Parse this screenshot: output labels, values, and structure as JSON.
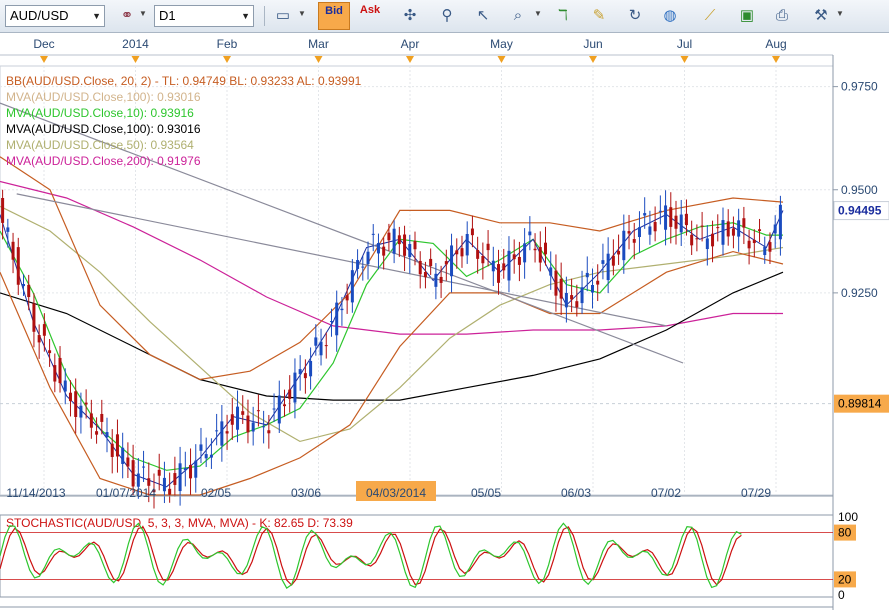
{
  "toolbar": {
    "symbol": "AUD/USD",
    "timeframe": "D1",
    "bid_label": "Bid",
    "ask_label": "Ask",
    "icons": [
      "link-icon",
      "line-chart-icon",
      "crosshair-icon",
      "zoom-icon",
      "cursor-icon",
      "zoom-in-icon",
      "zoom-out-icon",
      "indicator-icon",
      "drawing-icon",
      "refresh-icon",
      "globe-icon",
      "ruler-icon",
      "image-icon",
      "print-icon",
      "tools-icon"
    ]
  },
  "chart_data": {
    "type": "candlestick",
    "top_axis_labels": [
      "Dec",
      "2014",
      "Feb",
      "Mar",
      "Apr",
      "May",
      "Jun",
      "Jul",
      "Aug"
    ],
    "bottom_axis_labels": [
      "11/14/2013",
      "01/07/2014",
      "02/05",
      "03/06",
      "04/03/2014",
      "05/05",
      "06/03",
      "07/02",
      "07/29"
    ],
    "highlighted_date": "04/03/2014",
    "ylim": [
      0.876,
      0.98
    ],
    "yticks": [
      "0.9750",
      "0.9500",
      "0.9250"
    ],
    "current_price": "0.94495",
    "marked_level": "0.89814",
    "indicator_labels": [
      {
        "text": "BB(AUD/USD.Close, 20, 2) -  TL: 0.94749  BL: 0.93233  AL: 0.93991",
        "color": "#c65d22"
      },
      {
        "text": "MVA(AUD/USD.Close,100): 0.93016",
        "color": "#d2b48c"
      },
      {
        "text": "MVA(AUD/USD.Close,10): 0.93916",
        "color": "#2ec62e"
      },
      {
        "text": "MVA(AUD/USD.Close,100): 0.93016",
        "color": "#000000"
      },
      {
        "text": "MVA(AUD/USD.Close,50): 0.93564",
        "color": "#b0b070"
      },
      {
        "text": "MVA(AUD/USD.Close,200): 0.91976",
        "color": "#cc2299"
      }
    ],
    "series": [
      {
        "name": "MVA 200",
        "color": "#cc2299",
        "x": [
          0,
          0.08,
          0.16,
          0.24,
          0.32,
          0.4,
          0.48,
          0.56,
          0.64,
          0.72,
          0.8,
          0.88,
          0.94
        ],
        "y": [
          0.952,
          0.948,
          0.941,
          0.933,
          0.924,
          0.917,
          0.915,
          0.915,
          0.916,
          0.916,
          0.917,
          0.92,
          0.92
        ]
      },
      {
        "name": "MVA 100",
        "color": "#000000",
        "x": [
          0,
          0.08,
          0.16,
          0.24,
          0.32,
          0.4,
          0.48,
          0.56,
          0.64,
          0.72,
          0.8,
          0.88,
          0.94
        ],
        "y": [
          0.925,
          0.92,
          0.912,
          0.904,
          0.9,
          0.899,
          0.899,
          0.902,
          0.905,
          0.909,
          0.916,
          0.925,
          0.93
        ]
      },
      {
        "name": "MVA 50",
        "color": "#b0b070",
        "x": [
          0,
          0.06,
          0.12,
          0.18,
          0.24,
          0.3,
          0.36,
          0.42,
          0.48,
          0.54,
          0.6,
          0.66,
          0.72,
          0.8,
          0.88,
          0.94
        ],
        "y": [
          0.946,
          0.94,
          0.93,
          0.918,
          0.907,
          0.896,
          0.889,
          0.892,
          0.902,
          0.914,
          0.922,
          0.927,
          0.93,
          0.932,
          0.934,
          0.936
        ]
      },
      {
        "name": "MVA 10",
        "color": "#2ec62e",
        "x": [
          0,
          0.04,
          0.08,
          0.12,
          0.16,
          0.2,
          0.24,
          0.28,
          0.32,
          0.36,
          0.4,
          0.44,
          0.48,
          0.52,
          0.56,
          0.6,
          0.64,
          0.68,
          0.72,
          0.76,
          0.8,
          0.84,
          0.88,
          0.92,
          0.94
        ],
        "y": [
          0.94,
          0.925,
          0.905,
          0.892,
          0.885,
          0.882,
          0.883,
          0.89,
          0.893,
          0.897,
          0.908,
          0.927,
          0.938,
          0.937,
          0.929,
          0.933,
          0.938,
          0.927,
          0.925,
          0.934,
          0.938,
          0.941,
          0.942,
          0.939,
          0.939
        ]
      },
      {
        "name": "Price",
        "color": "#1a2d9e",
        "x": [
          0,
          0.04,
          0.08,
          0.12,
          0.16,
          0.2,
          0.24,
          0.28,
          0.32,
          0.36,
          0.4,
          0.44,
          0.48,
          0.52,
          0.56,
          0.6,
          0.64,
          0.68,
          0.72,
          0.76,
          0.8,
          0.84,
          0.88,
          0.92,
          0.94
        ],
        "y": [
          0.944,
          0.918,
          0.9,
          0.892,
          0.881,
          0.878,
          0.885,
          0.895,
          0.893,
          0.905,
          0.918,
          0.936,
          0.938,
          0.928,
          0.938,
          0.93,
          0.938,
          0.922,
          0.93,
          0.94,
          0.944,
          0.938,
          0.941,
          0.936,
          0.945
        ]
      },
      {
        "name": "BB upper",
        "color": "#c65d22",
        "x": [
          0,
          0.06,
          0.12,
          0.18,
          0.24,
          0.3,
          0.36,
          0.42,
          0.48,
          0.54,
          0.6,
          0.66,
          0.72,
          0.8,
          0.88,
          0.94
        ],
        "y": [
          0.958,
          0.95,
          0.922,
          0.91,
          0.904,
          0.906,
          0.913,
          0.925,
          0.945,
          0.945,
          0.942,
          0.942,
          0.94,
          0.945,
          0.948,
          0.947
        ]
      },
      {
        "name": "BB lower",
        "color": "#c65d22",
        "x": [
          0,
          0.06,
          0.12,
          0.18,
          0.24,
          0.3,
          0.36,
          0.42,
          0.48,
          0.54,
          0.6,
          0.66,
          0.72,
          0.8,
          0.88,
          0.94
        ],
        "y": [
          0.93,
          0.902,
          0.88,
          0.876,
          0.876,
          0.88,
          0.885,
          0.893,
          0.912,
          0.925,
          0.925,
          0.92,
          0.92,
          0.93,
          0.935,
          0.932
        ]
      },
      {
        "name": "Trendline 1",
        "color": "#8a8a9a",
        "x": [
          0,
          0.82
        ],
        "y": [
          0.971,
          0.908
        ]
      },
      {
        "name": "Trendline 2",
        "color": "#8a8a9a",
        "x": [
          0.02,
          0.8
        ],
        "y": [
          0.949,
          0.917
        ]
      }
    ],
    "stochastic": {
      "label": "STOCHASTIC(AUD/USD, 5, 3, 3, MVA, MVA) -  K: 82.65  D: 73.39",
      "levels": [
        "100",
        "80",
        "20",
        "0"
      ],
      "k_color": "#2ec62e",
      "d_color": "#cc1111"
    }
  }
}
